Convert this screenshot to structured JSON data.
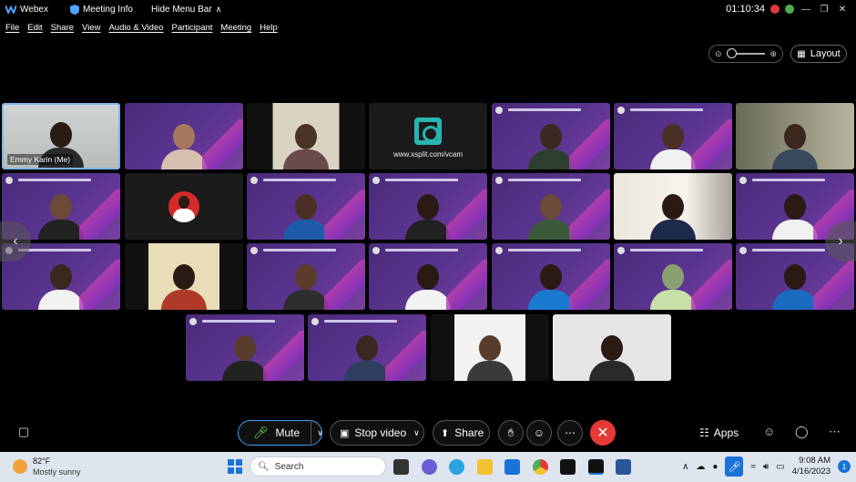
{
  "titlebar": {
    "app_name": "Webex",
    "meeting_info": "Meeting Info",
    "hide_menu": "Hide Menu Bar",
    "timer": "01:10:34"
  },
  "menu": [
    "File",
    "Edit",
    "Share",
    "View",
    "Audio & Video",
    "Participant",
    "Meeting",
    "Help"
  ],
  "toolbar": {
    "layout_label": "Layout"
  },
  "self_name": "Emmy Karin (Me)",
  "vcam_url": "www.xsplit.com/vcam",
  "controls": {
    "mute_label": "Mute",
    "stop_video_label": "Stop video",
    "share_label": "Share",
    "apps_label": "Apps"
  },
  "taskbar": {
    "temperature": "82°F",
    "weather": "Mostly sunny",
    "search_placeholder": "Search",
    "time": "9:08 AM",
    "date": "4/16/2023",
    "notification_count": "1"
  },
  "colors": {
    "accent": "#29b5b0",
    "end_call": "#e53935",
    "tile_purple": "#4a2a7a"
  }
}
